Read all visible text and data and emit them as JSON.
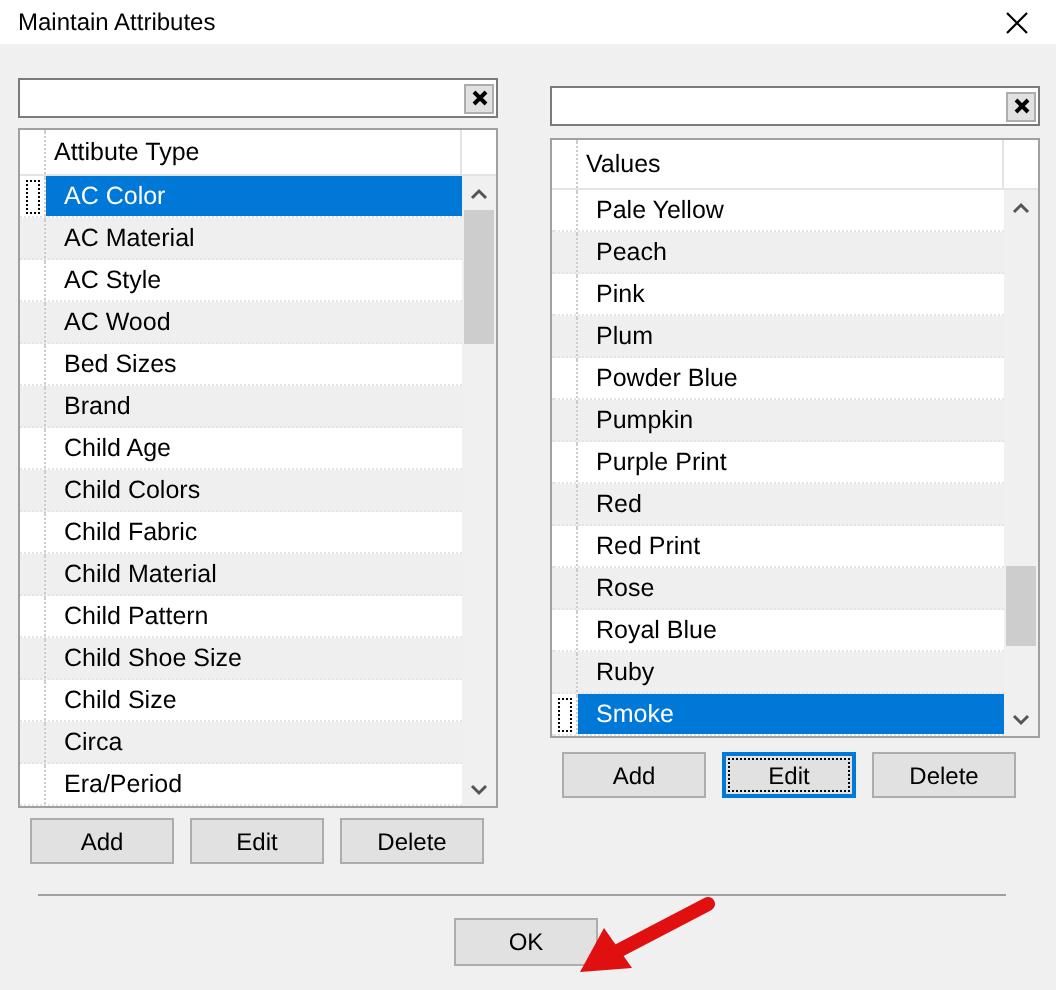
{
  "window": {
    "title": "Maintain Attributes"
  },
  "panels": [
    {
      "column": "Attibute Type",
      "rows": [
        {
          "label": "AC Color",
          "selected": true
        },
        {
          "label": "AC Material",
          "selected": false
        },
        {
          "label": "AC Style",
          "selected": false
        },
        {
          "label": "AC Wood",
          "selected": false
        },
        {
          "label": "Bed Sizes",
          "selected": false
        },
        {
          "label": "Brand",
          "selected": false
        },
        {
          "label": "Child Age",
          "selected": false
        },
        {
          "label": "Child Colors",
          "selected": false
        },
        {
          "label": "Child Fabric",
          "selected": false
        },
        {
          "label": "Child Material",
          "selected": false
        },
        {
          "label": "Child Pattern",
          "selected": false
        },
        {
          "label": "Child Shoe Size",
          "selected": false
        },
        {
          "label": "Child Size",
          "selected": false
        },
        {
          "label": "Circa",
          "selected": false
        },
        {
          "label": "Era/Period",
          "selected": false
        }
      ],
      "buttons": [
        {
          "label": "Add",
          "focused": false
        },
        {
          "label": "Edit",
          "focused": false
        },
        {
          "label": "Delete",
          "focused": false
        }
      ]
    },
    {
      "column": "Values",
      "rows": [
        {
          "label": "Pale Yellow",
          "selected": false
        },
        {
          "label": "Peach",
          "selected": false
        },
        {
          "label": "Pink",
          "selected": false
        },
        {
          "label": "Plum",
          "selected": false
        },
        {
          "label": "Powder Blue",
          "selected": false
        },
        {
          "label": "Pumpkin",
          "selected": false
        },
        {
          "label": "Purple Print",
          "selected": false
        },
        {
          "label": "Red",
          "selected": false
        },
        {
          "label": "Red Print",
          "selected": false
        },
        {
          "label": "Rose",
          "selected": false
        },
        {
          "label": "Royal Blue",
          "selected": false
        },
        {
          "label": "Ruby",
          "selected": false
        },
        {
          "label": "Smoke",
          "selected": true
        }
      ],
      "buttons": [
        {
          "label": "Add",
          "focused": false
        },
        {
          "label": "Edit",
          "focused": true
        },
        {
          "label": "Delete",
          "focused": false
        }
      ]
    }
  ],
  "ok_button": "OK"
}
